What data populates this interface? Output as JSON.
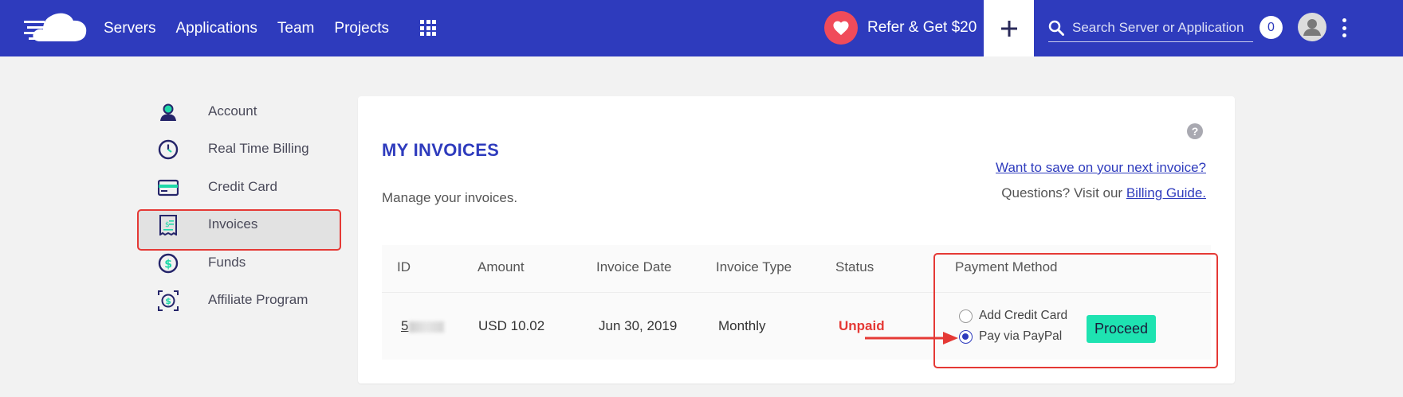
{
  "topbar": {
    "nav": [
      "Servers",
      "Applications",
      "Team",
      "Projects"
    ],
    "refer_label": "Refer & Get $20",
    "search_placeholder": "Search Server or Application",
    "notification_count": "0",
    "icons": {
      "logo": "cloud-logo",
      "apps": "grid-icon",
      "refer": "heart-icon",
      "add": "plus-icon",
      "search": "search-icon",
      "avatar": "user-icon",
      "more": "kebab-icon"
    }
  },
  "sidebar": {
    "items": [
      {
        "label": "Account",
        "icon": "user-icon"
      },
      {
        "label": "Real Time Billing",
        "icon": "clock-icon"
      },
      {
        "label": "Credit Card",
        "icon": "credit-card-icon"
      },
      {
        "label": "Invoices",
        "icon": "invoice-icon"
      },
      {
        "label": "Funds",
        "icon": "dollar-icon"
      },
      {
        "label": "Affiliate Program",
        "icon": "affiliate-icon"
      }
    ],
    "active": "Invoices"
  },
  "main": {
    "title": "MY INVOICES",
    "subtitle": "Manage your invoices.",
    "save_link": "Want to save on your next invoice?",
    "questions_prefix": "Questions? Visit our",
    "billing_guide_link": "Billing Guide.",
    "help_icon": "?"
  },
  "table": {
    "headers": [
      "ID",
      "Amount",
      "Invoice Date",
      "Invoice Type",
      "Status",
      "Payment Method"
    ],
    "rows": [
      {
        "id_visible": "5",
        "amount": "USD 10.02",
        "date": "Jun 30, 2019",
        "type": "Monthly",
        "status": "Unpaid"
      }
    ]
  },
  "payment": {
    "options": [
      "Add Credit Card",
      "Pay via PayPal"
    ],
    "selected": "Pay via PayPal",
    "proceed_label": "Proceed"
  },
  "colors": {
    "brand": "#2e3bbd",
    "accent": "#1ee3b1",
    "alert": "#e53935",
    "heart": "#f04b5a"
  }
}
